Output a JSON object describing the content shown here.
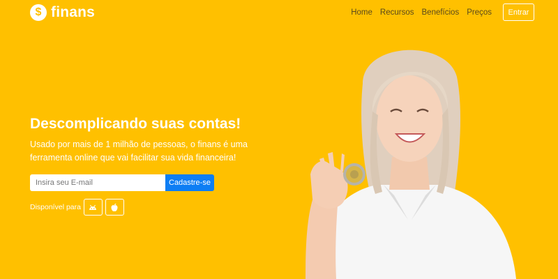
{
  "brand": {
    "logo_glyph": "$",
    "name": "finans"
  },
  "nav": {
    "items": [
      {
        "label": "Home"
      },
      {
        "label": "Recursos"
      },
      {
        "label": "Benefícios"
      },
      {
        "label": "Preços"
      }
    ],
    "login_label": "Entrar"
  },
  "hero": {
    "headline": "Descomplicando suas contas!",
    "subtext": "Usado por mais de 1 milhão de pessoas, o finans é uma ferramenta online que vai facilitar sua vida financeira!",
    "email_placeholder": "Insira seu E-mail",
    "signup_label": "Cadastre-se",
    "available_label": "Disponível para",
    "stores": [
      {
        "icon": "android-icon"
      },
      {
        "icon": "apple-icon"
      }
    ]
  },
  "colors": {
    "background": "#FFC000",
    "primary_button": "#0d7ef4",
    "text": "#ffffff"
  }
}
